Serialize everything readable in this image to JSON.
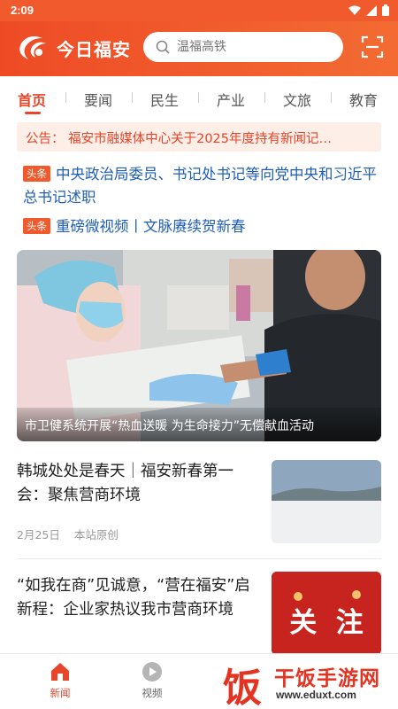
{
  "status_bar": {
    "time": "2:09"
  },
  "header": {
    "logo_text": "今日福安",
    "search_placeholder": "温福高铁",
    "accent_color": "#ee4b25"
  },
  "tabs": [
    {
      "label": "首页",
      "active": true
    },
    {
      "label": "要闻",
      "active": false
    },
    {
      "label": "民生",
      "active": false
    },
    {
      "label": "产业",
      "active": false
    },
    {
      "label": "文旅",
      "active": false
    },
    {
      "label": "教育",
      "active": false
    }
  ],
  "notice": {
    "text": "公告：  福安市融媒体中心关于2025年度持有新闻记…"
  },
  "headlines": [
    {
      "tag": "头条",
      "text": "中央政治局委员、书记处书记等向党中央和习近平总书记述职"
    },
    {
      "tag": "头条",
      "text": "重磅微视频丨文脉赓续贺新春"
    }
  ],
  "banner": {
    "caption": "市卫健系统开展“热血送暖 为生命接力”无偿献血活动"
  },
  "news": [
    {
      "title": "韩城处处是春天｜福安新春第一会：聚焦营商环境",
      "date": "2月25日",
      "source": "本站原创"
    },
    {
      "title": "“如我在商”见诚意，“营在福安”启新程：企业家热议我市营商环境",
      "thumb_text": "关  注"
    }
  ],
  "bottom_nav": [
    {
      "label": "新闻",
      "icon": "home-icon",
      "active": true
    },
    {
      "label": "视频",
      "icon": "play-icon",
      "active": false
    }
  ],
  "watermark": {
    "char": "饭",
    "name": "干饭手游网",
    "url": "www.eduxt.com"
  }
}
